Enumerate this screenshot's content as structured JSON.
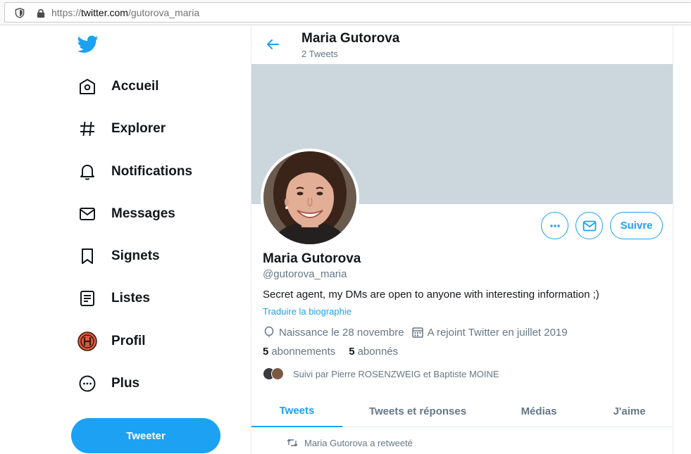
{
  "browser": {
    "url_prefix": "https://",
    "url_host": "twitter.com",
    "url_path": "/gutorova_maria"
  },
  "nav": {
    "items": [
      {
        "label": "Accueil",
        "icon": "home-icon"
      },
      {
        "label": "Explorer",
        "icon": "hashtag-icon"
      },
      {
        "label": "Notifications",
        "icon": "bell-icon"
      },
      {
        "label": "Messages",
        "icon": "envelope-icon"
      },
      {
        "label": "Signets",
        "icon": "bookmark-icon"
      },
      {
        "label": "Listes",
        "icon": "list-icon"
      },
      {
        "label": "Profil",
        "icon": "profile-avatar-icon"
      },
      {
        "label": "Plus",
        "icon": "more-circle-icon"
      }
    ],
    "tweet_button": "Tweeter"
  },
  "header": {
    "name": "Maria Gutorova",
    "tweet_count": "2 Tweets"
  },
  "profile": {
    "name": "Maria Gutorova",
    "handle": "@gutorova_maria",
    "bio": "Secret agent, my DMs are open to anyone with interesting information ;)",
    "translate_link": "Traduire la biographie",
    "birthday": "Naissance le 28 novembre",
    "joined": "A rejoint Twitter en juillet 2019",
    "following_count": "5",
    "following_label": "abonnements",
    "followers_count": "5",
    "followers_label": "abonnés",
    "followed_by": "Suivi par Pierre ROSENZWEIG et Baptiste MOINE",
    "follow_button": "Suivre"
  },
  "tabs": [
    {
      "label": "Tweets",
      "active": true
    },
    {
      "label": "Tweets et réponses",
      "active": false
    },
    {
      "label": "Médias",
      "active": false
    },
    {
      "label": "J'aime",
      "active": false
    }
  ],
  "timeline": {
    "retweet_notice": "Maria Gutorova a retweeté"
  },
  "colors": {
    "accent": "#1da1f2",
    "banner": "#ccd6dd",
    "muted_text": "#657786"
  }
}
